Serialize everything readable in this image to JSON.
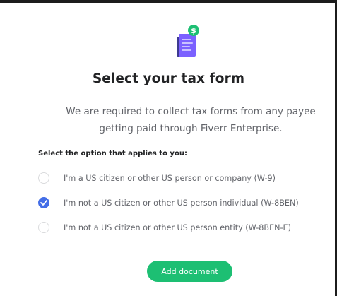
{
  "dialog": {
    "icon": "tax-document-dollar-icon",
    "title": "Select your tax form",
    "description_line1": "We are required to collect tax forms from any payee",
    "description_line2": "getting paid through Fiverr Enterprise.",
    "prompt": "Select the option that applies to you:",
    "options": [
      {
        "label": "I'm a US citizen or other US person or company (W-9)",
        "selected": false
      },
      {
        "label": "I'm not a US citizen or other US person individual (W-8BEN)",
        "selected": true
      },
      {
        "label": "I'm not a US citizen or other US person entity (W-8BEN-E)",
        "selected": false
      }
    ],
    "submit_label": "Add document"
  },
  "colors": {
    "accent_blue": "#446ee7",
    "button_green": "#1dbf73",
    "icon_purple": "#7b61ff",
    "icon_badge_green": "#1dbf73"
  }
}
